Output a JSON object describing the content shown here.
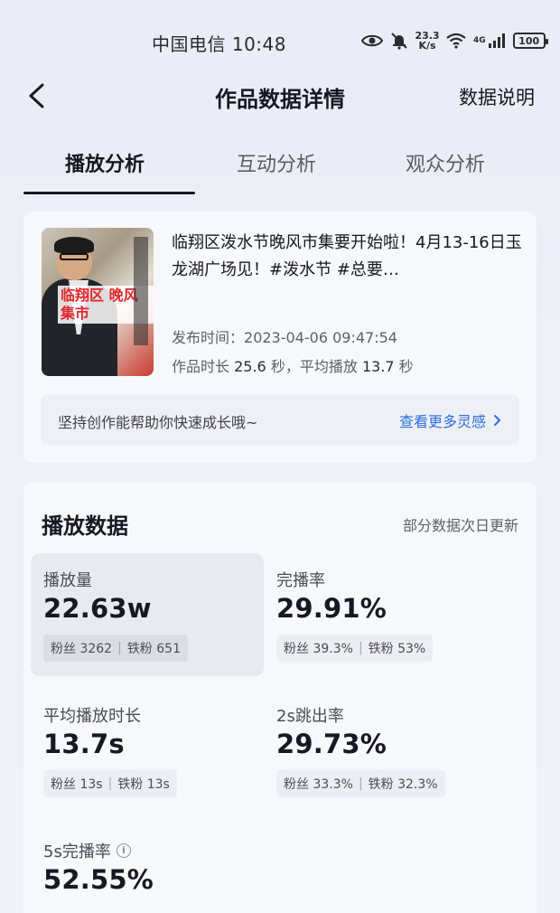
{
  "status_bar": {
    "carrier_time": "中国电信 10:48",
    "net_speed_value": "23.3",
    "net_speed_unit": "K/s",
    "network_type": "4G",
    "battery": "100",
    "icons": [
      "eye-icon",
      "mute-bell-icon",
      "wifi-icon",
      "signal-icon",
      "battery-icon"
    ]
  },
  "nav": {
    "title": "作品数据详情",
    "right_label": "数据说明",
    "back_icon": "chevron-left-icon"
  },
  "tabs": [
    {
      "label": "播放分析",
      "active": true
    },
    {
      "label": "互动分析",
      "active": false
    },
    {
      "label": "观众分析",
      "active": false
    }
  ],
  "video": {
    "thumb_overlay": "临翔区 晚风集市",
    "title": "临翔区泼水节晚风市集要开始啦！4月13-16日玉龙湖广场见！#泼水节 #总要…",
    "publish_label": "发布时间：",
    "publish_time": "2023-04-06 09:47:54",
    "duration_label": "作品时长",
    "duration_value": "25.6",
    "duration_unit": "秒，平均播放",
    "avg_play_value": "13.7",
    "avg_play_unit": "秒"
  },
  "tips": {
    "text": "坚持创作能帮助你快速成长哦~",
    "link": "查看更多灵感",
    "link_icon": "chevron-right-icon"
  },
  "stats": {
    "title": "播放数据",
    "note": "部分数据次日更新",
    "metrics": [
      {
        "label": "播放量",
        "value": "22.63w",
        "fans": "粉丝 3262",
        "iron_fans": "铁粉 651",
        "highlighted": true
      },
      {
        "label": "完播率",
        "value": "29.91%",
        "fans": "粉丝 39.3%",
        "iron_fans": "铁粉 53%"
      },
      {
        "label": "平均播放时长",
        "value": "13.7s",
        "fans": "粉丝 13s",
        "iron_fans": "铁粉 13s"
      },
      {
        "label": "2s跳出率",
        "value": "29.73%",
        "fans": "粉丝 33.3%",
        "iron_fans": "铁粉 32.3%"
      },
      {
        "label": "5s完播率",
        "value": "52.55%",
        "info_icon": "info-circle-icon"
      }
    ]
  },
  "colors": {
    "link": "#2b6de0",
    "text_primary": "#161823",
    "text_secondary": "#5d5f69",
    "card_bg": "#f7f8fc"
  }
}
